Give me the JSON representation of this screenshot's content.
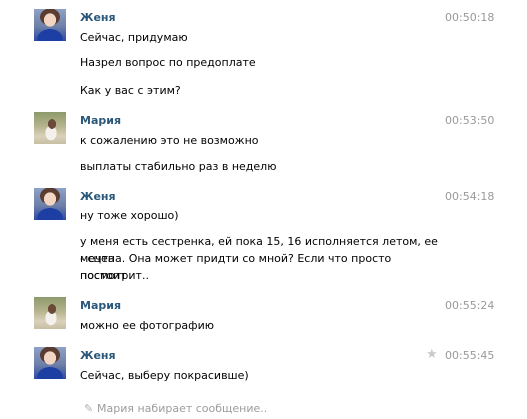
{
  "messages": [
    {
      "author": "Женя",
      "time": "00:50:18",
      "lines": [
        "Сейчас, придумаю",
        "Назрел вопрос по предоплате",
        "Как у вас с этим?"
      ]
    },
    {
      "author": "Мария",
      "time": "00:53:50",
      "lines": [
        "к сожалению это не возможно",
        "выплаты стабильно раз в неделю"
      ]
    },
    {
      "author": "Женя",
      "time": "00:54:18",
      "lines": [
        "ну тоже хорошо)",
        "у меня есть сестренка, ей пока 15, 16 исполняется летом, ее мечта",
        "- сцена. Она может придти со мной? Если что просто постоит",
        "посмотрит.."
      ]
    },
    {
      "author": "Мария",
      "time": "00:55:24",
      "lines": [
        "можно ее фотографию"
      ]
    },
    {
      "author": "Женя",
      "time": "00:55:45",
      "lines": [
        "Сейчас, выберу покрасивше)"
      ]
    }
  ],
  "typing_indicator": "Мария набирает сообщение..",
  "icons": {
    "star": "star-icon",
    "pencil": "pencil-icon"
  },
  "colors": {
    "author": "#2b587a",
    "time": "#999999",
    "typing": "#9c9c9c"
  }
}
